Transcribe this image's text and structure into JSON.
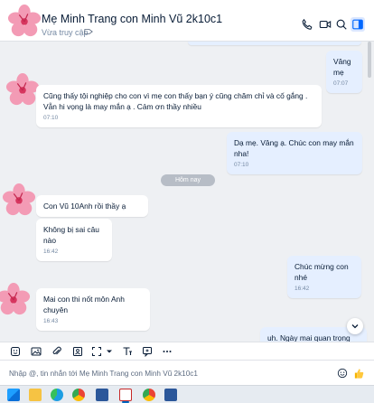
{
  "header": {
    "title": "Mẹ Minh Trang con Minh Vũ 2k10c1",
    "subtitle": "Vừa truy cập"
  },
  "messages": [
    {
      "id": "m1",
      "dir": "out",
      "text": "Vâng mẹ",
      "time": "07:07"
    },
    {
      "id": "m2",
      "dir": "in",
      "text": "Cũng thấy tội nghiệp cho con vì mẹ con thấy bạn ý cũng chăm chỉ và cố gắng . Vẫn hi vọng là may mắn ạ . Cảm ơn thầy nhiều",
      "time": "07:10"
    },
    {
      "id": "m3",
      "dir": "out",
      "text": "Dạ mẹ. Vâng ạ. Chúc con may mắn nha!",
      "time": "07:10"
    },
    {
      "id": "m4",
      "dir": "in",
      "text": "Con Vũ 10Anh rồi thầy ạ",
      "time": ""
    },
    {
      "id": "m5",
      "dir": "in",
      "text": "Không bị sai câu nào",
      "time": "16:42"
    },
    {
      "id": "m6",
      "dir": "out",
      "text": "Chúc mừng con nhé",
      "time": "16:42"
    },
    {
      "id": "m7",
      "dir": "in",
      "text": "Mai con thi nốt môn Anh chuyên",
      "time": "16:43"
    },
    {
      "id": "m8",
      "dir": "out",
      "text": "uh. Ngày mai quan trọng lắm",
      "time": ""
    }
  ],
  "day_separator": "Hôm nay",
  "composer": {
    "placeholder": "Nhập @, tin nhắn tới Mẹ Minh Trang con Minh Vũ 2k10c1"
  },
  "icons": {
    "header": [
      "phone-icon",
      "video-call-icon",
      "search-icon",
      "sidebar-toggle-icon"
    ],
    "toolbar": [
      "sticker-icon",
      "image-icon",
      "attachment-icon",
      "contact-card-icon",
      "screenshot-icon",
      "format-icon",
      "quote-icon",
      "more-icon"
    ],
    "composer": [
      "emoji-icon",
      "thumbs-up-icon"
    ]
  },
  "colors": {
    "accent": "#0068ff",
    "outgoing_bubble": "#e5efff",
    "incoming_bubble": "#ffffff",
    "chat_background": "#eef0f3"
  }
}
